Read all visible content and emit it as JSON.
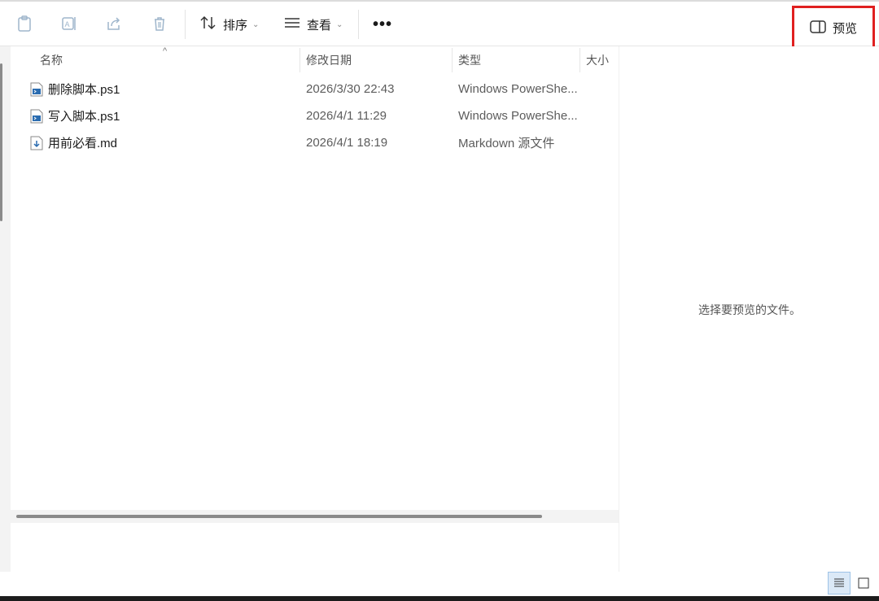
{
  "toolbar": {
    "icons": [
      "clipboard-icon",
      "rename-icon",
      "share-icon",
      "delete-icon"
    ],
    "sort_label": "排序",
    "view_label": "查看",
    "more_label": "•••",
    "preview_label": "预览"
  },
  "columns": {
    "name": "名称",
    "date": "修改日期",
    "type": "类型",
    "size": "大小",
    "sort_indicator": "^"
  },
  "files": [
    {
      "name": "删除脚本.ps1",
      "date": "2026/3/30 22:43",
      "type": "Windows PowerShe...",
      "icon": "powershell-file-icon"
    },
    {
      "name": "写入脚本.ps1",
      "date": "2026/4/1 11:29",
      "type": "Windows PowerShe...",
      "icon": "powershell-file-icon"
    },
    {
      "name": "用前必看.md",
      "date": "2026/4/1 18:19",
      "type": "Markdown 源文件",
      "icon": "markdown-file-icon"
    }
  ],
  "preview": {
    "message": "选择要预览的文件。"
  },
  "colors": {
    "highlight": "#e02020",
    "accent": "#0067c0"
  }
}
